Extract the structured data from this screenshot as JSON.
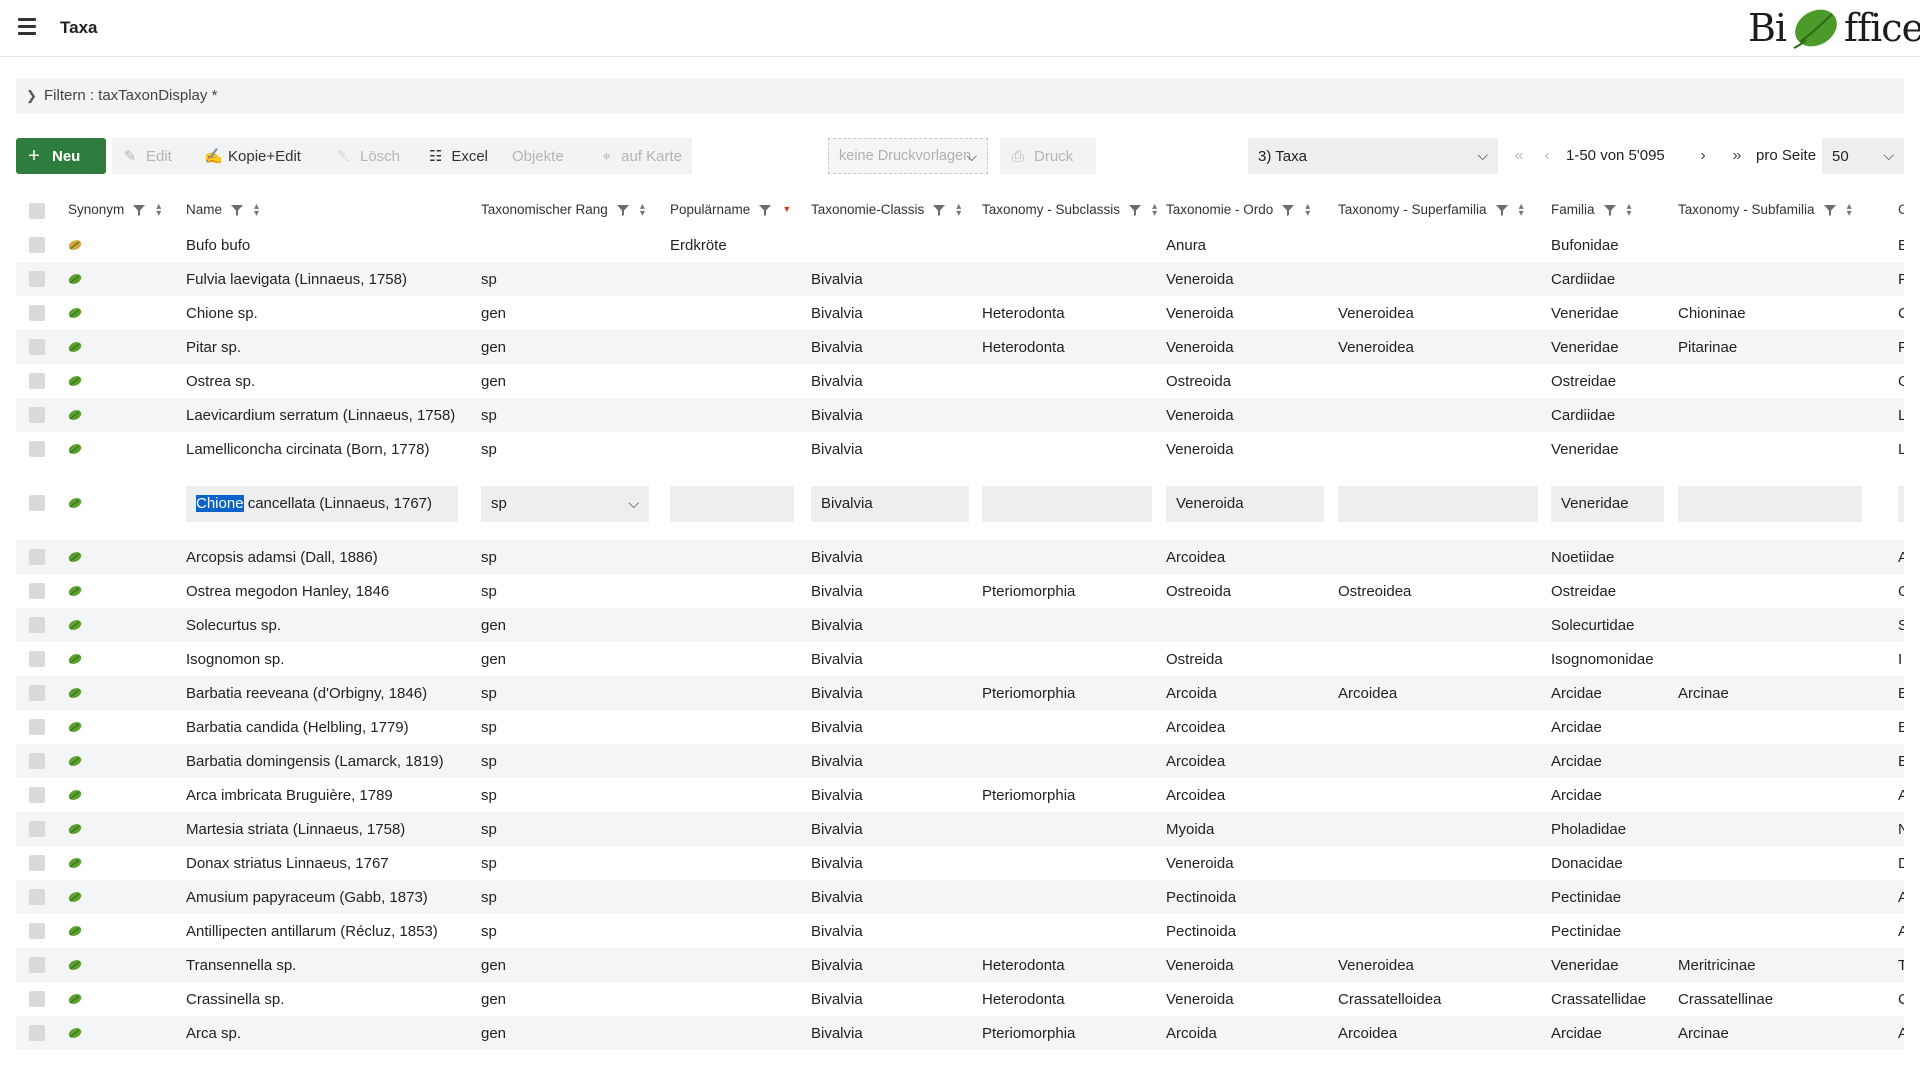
{
  "header": {
    "title": "Taxa",
    "logo_text_left": "Bi",
    "logo_text_right": "ffice"
  },
  "filter": {
    "label": "Filtern : taxTaxonDisplay *"
  },
  "toolbar": {
    "new": "Neu",
    "edit": "Edit",
    "copy_edit": "Kopie+Edit",
    "delete": "Lösch",
    "excel": "Excel",
    "objects": "Objekte",
    "map": "auf Karte",
    "print_template": "keine Druckvorlagen",
    "print": "Druck",
    "view": "3) Taxa",
    "range": "1-50 von 5'095",
    "per_page_label": "pro Seite",
    "per_page": "50"
  },
  "columns": [
    "Synonym",
    "Name",
    "Taxonomischer Rang",
    "Populärname",
    "Taxonomie-Classis",
    "Taxonomy - Subclassis",
    "Taxonomie - Ordo",
    "Taxonomy - Superfamilia",
    "Familia",
    "Taxonomy - Subfamilia"
  ],
  "rows": [
    {
      "leaf": "orange",
      "name": "Bufo bufo",
      "rank": "",
      "popular": "Erdkröte",
      "classis": "",
      "subclassis": "",
      "ordo": "Anura",
      "superfamilia": "",
      "familia": "Bufonidae",
      "subfamilia": "",
      "cut": "E"
    },
    {
      "leaf": "green",
      "name": "Fulvia laevigata (Linnaeus, 1758)",
      "rank": "sp",
      "popular": "",
      "classis": "Bivalvia",
      "subclassis": "",
      "ordo": "Veneroida",
      "superfamilia": "",
      "familia": "Cardiidae",
      "subfamilia": "",
      "cut": "F"
    },
    {
      "leaf": "green",
      "name": "Chione sp.",
      "rank": "gen",
      "popular": "",
      "classis": "Bivalvia",
      "subclassis": "Heterodonta",
      "ordo": "Veneroida",
      "superfamilia": "Veneroidea",
      "familia": "Veneridae",
      "subfamilia": "Chioninae",
      "cut": "C"
    },
    {
      "leaf": "green",
      "name": "Pitar sp.",
      "rank": "gen",
      "popular": "",
      "classis": "Bivalvia",
      "subclassis": "Heterodonta",
      "ordo": "Veneroida",
      "superfamilia": "Veneroidea",
      "familia": "Veneridae",
      "subfamilia": "Pitarinae",
      "cut": "P"
    },
    {
      "leaf": "green",
      "name": "Ostrea sp.",
      "rank": "gen",
      "popular": "",
      "classis": "Bivalvia",
      "subclassis": "",
      "ordo": "Ostreoida",
      "superfamilia": "",
      "familia": "Ostreidae",
      "subfamilia": "",
      "cut": "O"
    },
    {
      "leaf": "green",
      "name": "Laevicardium serratum (Linnaeus, 1758)",
      "rank": "sp",
      "popular": "",
      "classis": "Bivalvia",
      "subclassis": "",
      "ordo": "Veneroida",
      "superfamilia": "",
      "familia": "Cardiidae",
      "subfamilia": "",
      "cut": "L"
    },
    {
      "leaf": "green",
      "name": "Lamelliconcha circinata (Born, 1778)",
      "rank": "sp",
      "popular": "",
      "classis": "Bivalvia",
      "subclassis": "",
      "ordo": "Veneroida",
      "superfamilia": "",
      "familia": "Veneridae",
      "subfamilia": "",
      "cut": "L"
    }
  ],
  "edit_row": {
    "name_selected": "Chione",
    "name_rest": " cancellata (Linnaeus, 1767)",
    "rank": "sp",
    "popular": "",
    "classis": "Bivalvia",
    "subclassis": "",
    "ordo": "Veneroida",
    "superfamilia": "",
    "familia": "Veneridae",
    "subfamilia": ""
  },
  "rows2": [
    {
      "leaf": "green",
      "name": "Arcopsis adamsi (Dall, 1886)",
      "rank": "sp",
      "classis": "Bivalvia",
      "subclassis": "",
      "ordo": "Arcoidea",
      "superfamilia": "",
      "familia": "Noetiidae",
      "subfamilia": "",
      "cut": "A"
    },
    {
      "leaf": "green",
      "name": "Ostrea megodon Hanley, 1846",
      "rank": "sp",
      "classis": "Bivalvia",
      "subclassis": "Pteriomorphia",
      "ordo": "Ostreoida",
      "superfamilia": "Ostreoidea",
      "familia": "Ostreidae",
      "subfamilia": "",
      "cut": "O"
    },
    {
      "leaf": "green",
      "name": "Solecurtus sp.",
      "rank": "gen",
      "classis": "Bivalvia",
      "subclassis": "",
      "ordo": "",
      "superfamilia": "",
      "familia": "Solecurtidae",
      "subfamilia": "",
      "cut": "S"
    },
    {
      "leaf": "green",
      "name": "Isognomon sp.",
      "rank": "gen",
      "classis": "Bivalvia",
      "subclassis": "",
      "ordo": "Ostreida",
      "superfamilia": "",
      "familia": "Isognomonidae",
      "subfamilia": "",
      "cut": "I"
    },
    {
      "leaf": "green",
      "name": "Barbatia reeveana (d'Orbigny, 1846)",
      "rank": "sp",
      "classis": "Bivalvia",
      "subclassis": "Pteriomorphia",
      "ordo": "Arcoida",
      "superfamilia": "Arcoidea",
      "familia": "Arcidae",
      "subfamilia": "Arcinae",
      "cut": "E"
    },
    {
      "leaf": "green",
      "name": "Barbatia candida (Helbling, 1779)",
      "rank": "sp",
      "classis": "Bivalvia",
      "subclassis": "",
      "ordo": "Arcoidea",
      "superfamilia": "",
      "familia": "Arcidae",
      "subfamilia": "",
      "cut": "E"
    },
    {
      "leaf": "green",
      "name": "Barbatia domingensis (Lamarck, 1819)",
      "rank": "sp",
      "classis": "Bivalvia",
      "subclassis": "",
      "ordo": "Arcoidea",
      "superfamilia": "",
      "familia": "Arcidae",
      "subfamilia": "",
      "cut": "E"
    },
    {
      "leaf": "green",
      "name": "Arca imbricata Bruguière, 1789",
      "rank": "sp",
      "classis": "Bivalvia",
      "subclassis": "Pteriomorphia",
      "ordo": "Arcoidea",
      "superfamilia": "",
      "familia": "Arcidae",
      "subfamilia": "",
      "cut": "A"
    },
    {
      "leaf": "green",
      "name": "Martesia striata (Linnaeus, 1758)",
      "rank": "sp",
      "classis": "Bivalvia",
      "subclassis": "",
      "ordo": "Myoida",
      "superfamilia": "",
      "familia": "Pholadidae",
      "subfamilia": "",
      "cut": "N"
    },
    {
      "leaf": "green",
      "name": "Donax striatus Linnaeus, 1767",
      "rank": "sp",
      "classis": "Bivalvia",
      "subclassis": "",
      "ordo": "Veneroida",
      "superfamilia": "",
      "familia": "Donacidae",
      "subfamilia": "",
      "cut": "D"
    },
    {
      "leaf": "green",
      "name": "Amusium papyraceum (Gabb, 1873)",
      "rank": "sp",
      "classis": "Bivalvia",
      "subclassis": "",
      "ordo": "Pectinoida",
      "superfamilia": "",
      "familia": "Pectinidae",
      "subfamilia": "",
      "cut": "A"
    },
    {
      "leaf": "green",
      "name": "Antillipecten antillarum (Récluz, 1853)",
      "rank": "sp",
      "classis": "Bivalvia",
      "subclassis": "",
      "ordo": "Pectinoida",
      "superfamilia": "",
      "familia": "Pectinidae",
      "subfamilia": "",
      "cut": "A"
    },
    {
      "leaf": "green",
      "name": "Transennella sp.",
      "rank": "gen",
      "classis": "Bivalvia",
      "subclassis": "Heterodonta",
      "ordo": "Veneroida",
      "superfamilia": "Veneroidea",
      "familia": "Veneridae",
      "subfamilia": "Meritricinae",
      "cut": "T"
    },
    {
      "leaf": "green",
      "name": "Crassinella sp.",
      "rank": "gen",
      "classis": "Bivalvia",
      "subclassis": "Heterodonta",
      "ordo": "Veneroida",
      "superfamilia": "Crassatelloidea",
      "familia": "Crassatellidae",
      "subfamilia": "Crassatellinae",
      "cut": "C"
    },
    {
      "leaf": "green",
      "name": "Arca sp.",
      "rank": "gen",
      "classis": "Bivalvia",
      "subclassis": "Pteriomorphia",
      "ordo": "Arcoida",
      "superfamilia": "Arcoidea",
      "familia": "Arcidae",
      "subfamilia": "Arcinae",
      "cut": "A"
    }
  ],
  "colors": {
    "primary_green": "#2f7d3c",
    "leaf_green": "#5aa02c",
    "leaf_orange": "#d9a23a",
    "selection_blue": "#0b62c8",
    "row_alt": "#f4f5f6"
  }
}
